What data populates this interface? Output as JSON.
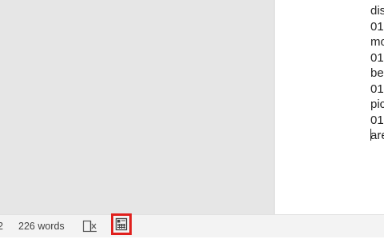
{
  "document": {
    "lines": [
      "dis",
      "01",
      "mo",
      "01",
      "be",
      "01",
      "pic",
      "01",
      "are"
    ]
  },
  "statusbar": {
    "page_fragment": "2",
    "word_count": "226 words",
    "focus_icon": "focus-mode-icon",
    "print_layout_icon": "print-layout-icon",
    "highlight_color": "#e0201d"
  }
}
